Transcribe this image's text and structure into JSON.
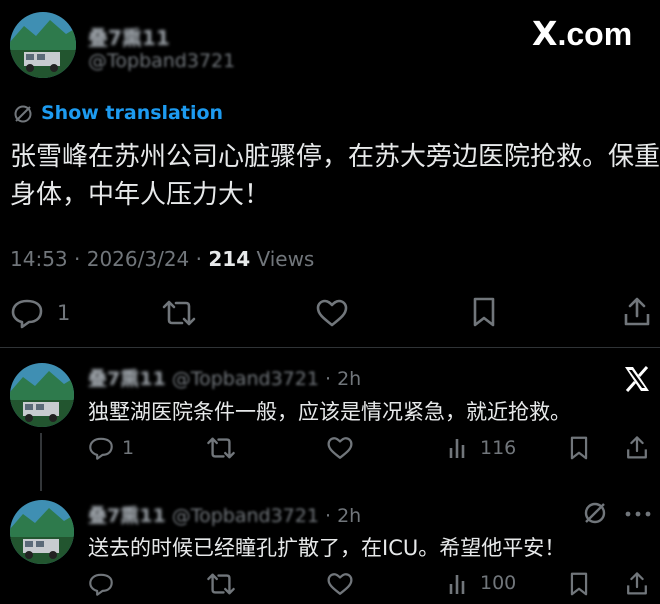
{
  "main_post": {
    "display_name": "叠7熏11",
    "handle": "@Topband3721",
    "show_translation": "Show translation",
    "text_line1": "张雪峰在苏州公司心脏骤停，在苏大旁边医院抢救。保重",
    "text_line2": "身体，中年人压力大！",
    "time": "14:53",
    "date": "2026/3/24",
    "views_count": "214",
    "views_label": "Views",
    "reply_count": "1"
  },
  "watermark": {
    "x_logo": "X",
    "domain": ".com"
  },
  "replies": [
    {
      "display_name": "叠7熏11",
      "handle": "@Topband3721",
      "age": "2h",
      "text": "独墅湖医院条件一般，应该是情况紧急，就近抢救。",
      "reply_count": "1",
      "views_count": "116"
    },
    {
      "display_name": "叠7熏11",
      "handle": "@Topband3721",
      "age": "2h",
      "text": "送去的时候已经瞳孔扩散了，在ICU。希望他平安！",
      "views_count": "100"
    }
  ],
  "colors": {
    "background": "#000000",
    "text": "#e7e9ea",
    "muted": "#71767b",
    "link": "#1d9bf0",
    "divider": "#2f3336"
  }
}
